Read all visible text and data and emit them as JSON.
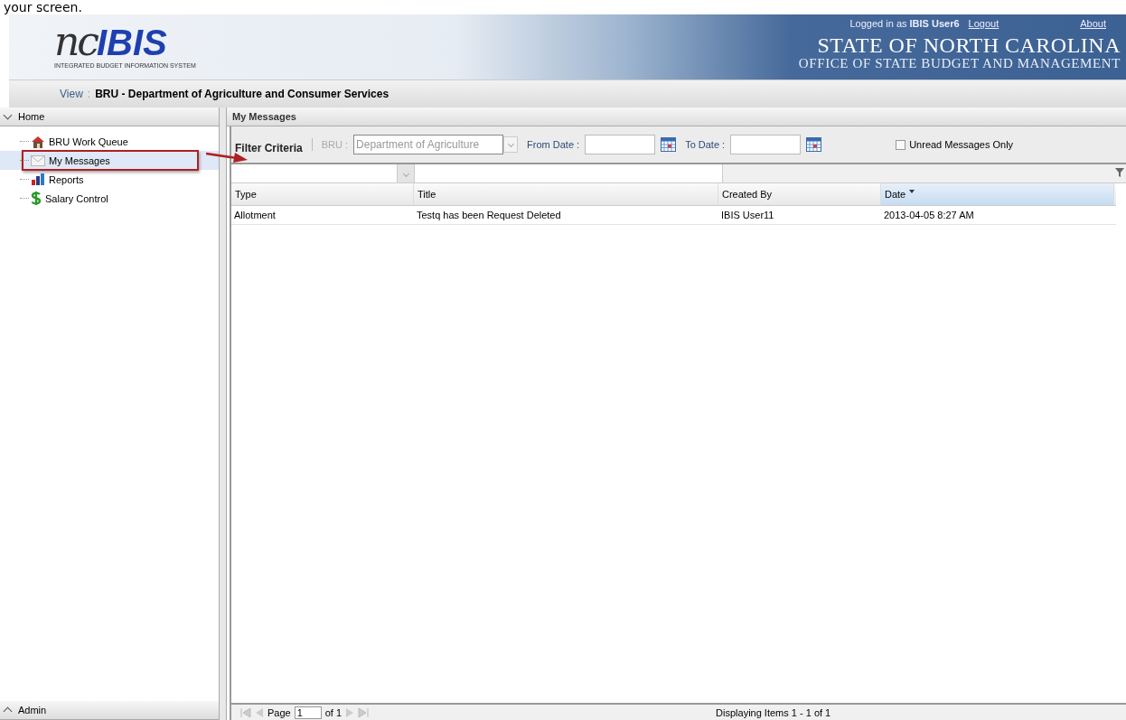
{
  "document_text": "your screen.",
  "header": {
    "logo": {
      "script": "nc",
      "bold": "IBIS",
      "tagline": "INTEGRATED BUDGET INFORMATION SYSTEM"
    },
    "login": "Logged in as **IBIS User6**",
    "links": [
      "Logout",
      "About"
    ],
    "title": "STATE OF NORTH CAROLINA",
    "subtitle": "OFFICE OF STATE BUDGET AND MANAGEMENT"
  },
  "view": {
    "label": "View",
    "separator": ":",
    "value": "BRU - Department of Agriculture and Consumer Services"
  },
  "sidebar": {
    "sections": [
      {
        "title": "Home",
        "expanded": true
      },
      {
        "title": "Admin",
        "expanded": false
      }
    ],
    "items": [
      {
        "label": "BRU Work Queue",
        "kind": "house",
        "selected": false
      },
      {
        "label": "My Messages",
        "kind": "mail",
        "selected": true
      },
      {
        "label": "Reports",
        "kind": "chart",
        "selected": false
      },
      {
        "label": "Salary Control",
        "kind": "dollar",
        "selected": false
      }
    ]
  },
  "main": {
    "title": "My Messages",
    "filter": {
      "label": "Filter Criteria",
      "bru_label": "BRU :",
      "bru_value": "Department of Agriculture",
      "bru_disabled": true,
      "from_label": "From Date :",
      "to_label": "To Date :",
      "unread": {
        "label": "Unread Messages Only",
        "checked": false
      }
    },
    "table": {
      "columns": [
        {
          "label": "Type",
          "sorted": false
        },
        {
          "label": "Title",
          "sorted": false
        },
        {
          "label": "Created By",
          "sorted": false
        },
        {
          "label": "Date",
          "sorted": true
        }
      ],
      "rows": [
        [
          "Allotment",
          "Testq has been Request Deleted",
          "IBIS User11",
          "2013-04-05 8:27 AM"
        ]
      ]
    },
    "pager": {
      "page_label": "Page",
      "page": "1",
      "of": "of 1",
      "status": "Displaying Items 1 - 1 of 1"
    }
  }
}
